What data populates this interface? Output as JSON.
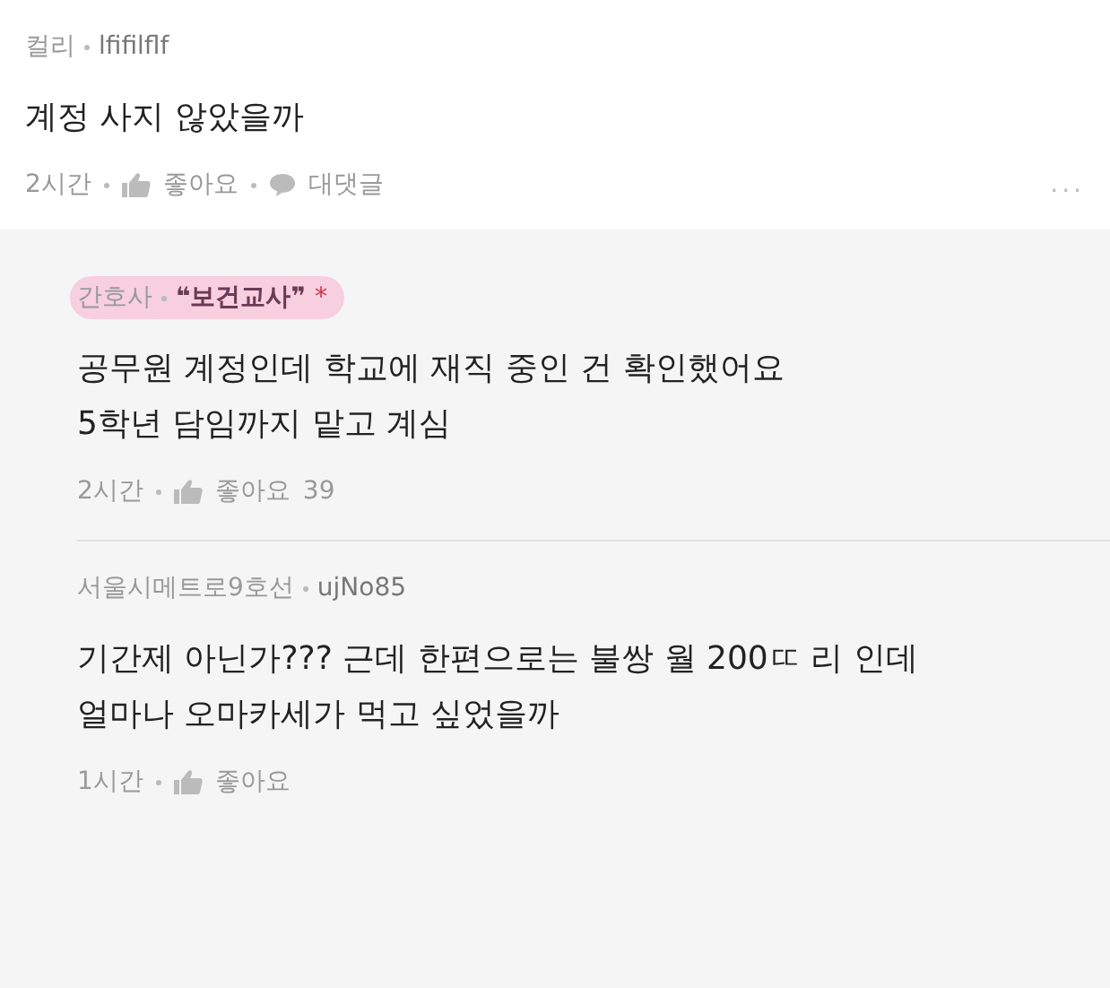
{
  "comments": [
    {
      "kind": "top",
      "author_group": "컬리",
      "author_name": "lfifilflf",
      "highlighted": false,
      "body": [
        "계정 사지 않았을까"
      ],
      "time": "2시간",
      "like_label": "좋아요",
      "reply_label": "대댓글",
      "more": "..."
    },
    {
      "kind": "reply",
      "author_group": "간호사",
      "author_name": "❝보건교사❞",
      "highlighted": true,
      "badge_star": "*",
      "body": [
        "공무원 계정인데 학교에 재직 중인 건 확인했어요",
        "5학년 담임까지 맡고 계심"
      ],
      "time": "2시간",
      "like_label": "좋아요",
      "like_count": "39"
    },
    {
      "kind": "reply",
      "author_group": "서울시메트로9호선",
      "author_name": "ujNo85",
      "highlighted": false,
      "body": [
        "기간제 아닌가??? 근데 한편으로는 불쌍 월 200ㄸ 리 인데",
        "얼마나 오마카세가 먹고 싶었을까"
      ],
      "time": "1시간",
      "like_label": "좋아요"
    }
  ]
}
